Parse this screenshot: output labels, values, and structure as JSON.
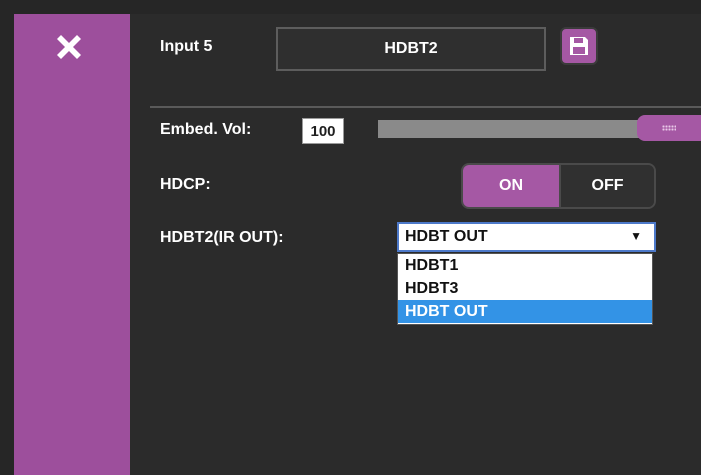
{
  "header": {
    "input_label": "Input 5",
    "input_name": "HDBT2"
  },
  "audio": {
    "volume_label": "Embed. Vol:",
    "volume_value": "100",
    "volume_level_percent": 100
  },
  "hdcp": {
    "label": "HDCP:",
    "on_label": "ON",
    "off_label": "OFF",
    "state": "ON"
  },
  "ir_out": {
    "label": "HDBT2(IR OUT):",
    "selected": "HDBT OUT",
    "options": [
      "HDBT1",
      "HDBT3",
      "HDBT OUT"
    ]
  },
  "icons": {
    "close": "close-icon",
    "save": "save-icon",
    "caret": "caret-down-icon"
  },
  "colors": {
    "accent": "#a558a4",
    "sidebar": "#9d4f9c",
    "background": "#262626",
    "selection": "#3393e6"
  }
}
